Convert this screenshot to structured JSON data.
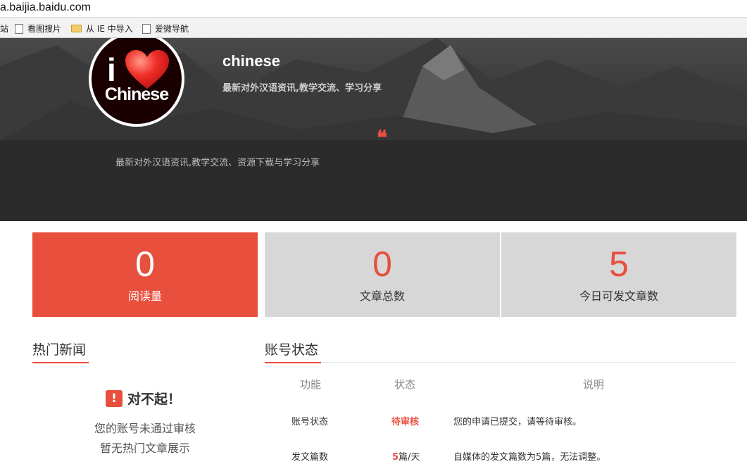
{
  "browser": {
    "address": "a.baijia.baidu.com",
    "bookmarks": [
      {
        "label": "站",
        "icon": "page-icon"
      },
      {
        "label": "看图搜片",
        "icon": "page-icon"
      },
      {
        "label": "从 IE 中导入",
        "icon": "folder-icon"
      },
      {
        "label": "爱微导航",
        "icon": "page-icon"
      }
    ]
  },
  "header": {
    "logo_letter": "i",
    "logo_word": "Chinese",
    "title": "chinese",
    "subtitle": "最新对外汉语资讯,教学交流、学习分享",
    "quote_mark": "❝",
    "description": "最新对外汉语资讯,教学交流、资源下载与学习分享"
  },
  "stats": [
    {
      "value": "0",
      "label": "阅读量"
    },
    {
      "value": "0",
      "label": "文章总数"
    },
    {
      "value": "5",
      "label": "今日可发文章数"
    }
  ],
  "hot_news": {
    "title": "热门新闻",
    "alert_icon": "!",
    "alert_title": "对不起！",
    "lines": [
      "您的账号未通过审核",
      "暂无热门文章展示"
    ]
  },
  "account": {
    "title": "账号状态",
    "headers": [
      "功能",
      "状态",
      "说明"
    ],
    "rows": [
      {
        "feature": "账号状态",
        "status": "待审核",
        "status_unit": "",
        "note": "您的申请已提交，请等待审核。"
      },
      {
        "feature": "发文篇数",
        "status": "5",
        "status_unit": "篇/天",
        "note": "自媒体的发文篇数为5篇，无法调整。"
      }
    ]
  },
  "colors": {
    "accent": "#e84f3d",
    "card_gray": "#d7d7d7",
    "banner": "#2b2b2b"
  }
}
